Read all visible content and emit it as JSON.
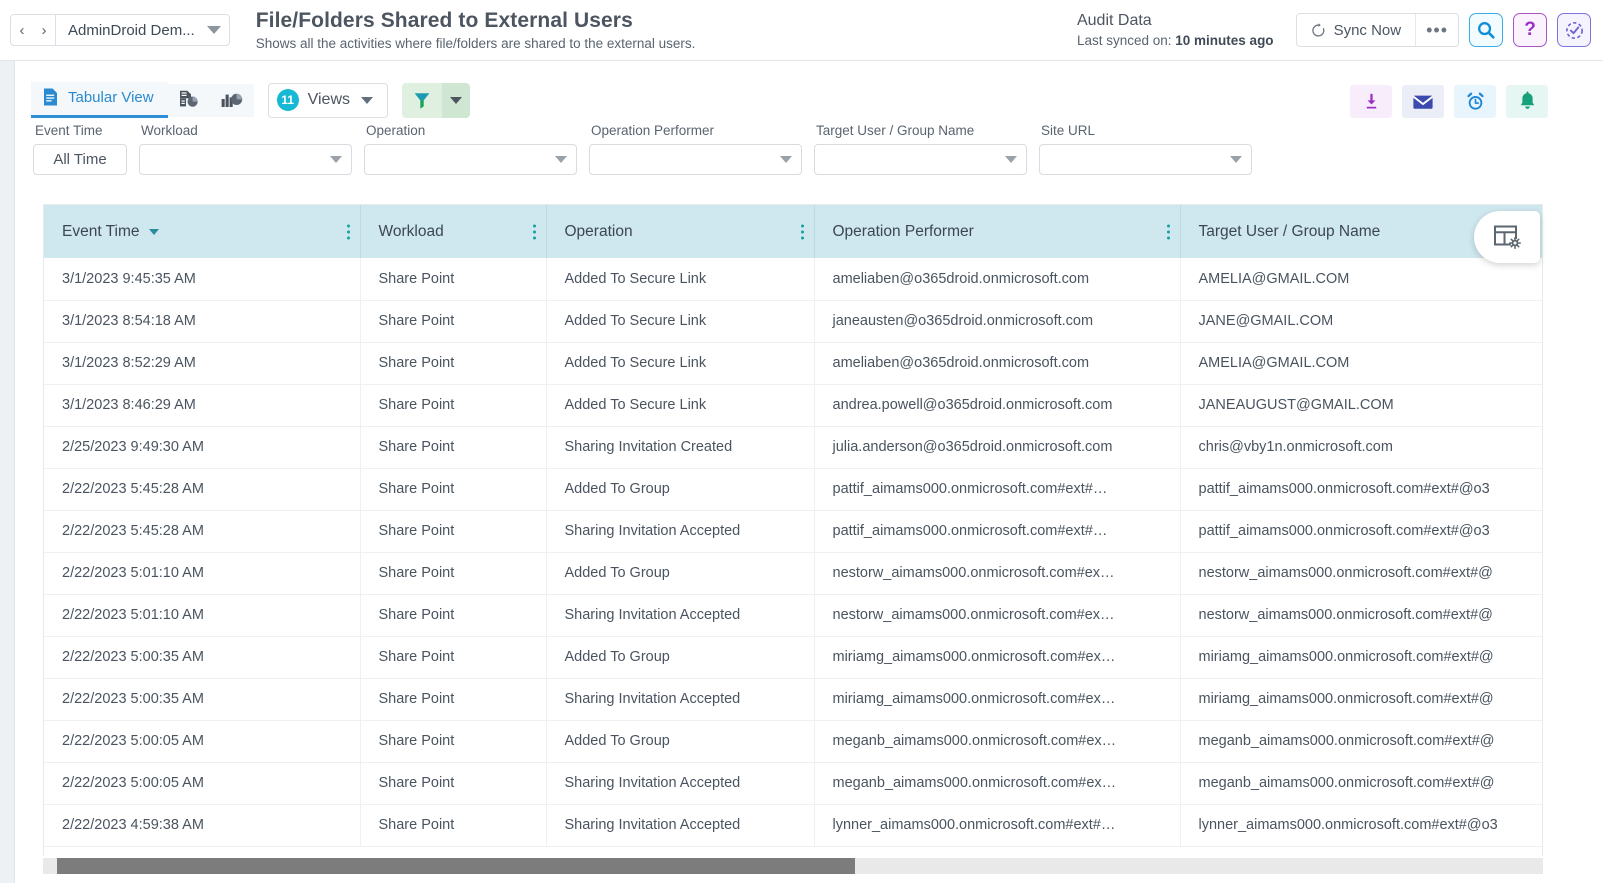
{
  "header": {
    "nav_back": "‹",
    "nav_forward": "›",
    "tenant_name": "AdminDroid Dem...",
    "title": "File/Folders Shared to External Users",
    "subtitle": "Shows all the activities where file/folders are shared to the external users.",
    "audit_label": "Audit Data",
    "sync_prefix": "Last synced on: ",
    "sync_value": "10 minutes ago",
    "sync_button": "Sync Now",
    "more_button": "•••",
    "icons": {
      "search": "search-icon",
      "help": "?",
      "check": "check-circle-icon"
    }
  },
  "viewbar": {
    "tabular_label": "Tabular View",
    "tabular_icon": "document-icon",
    "report_icon": "document-chart-icon",
    "chart_icon": "bar-pie-chart-icon",
    "views_count": "11",
    "views_label": "Views",
    "filter_icon": "funnel-icon"
  },
  "actions": [
    {
      "name": "download-button",
      "icon": "download-icon"
    },
    {
      "name": "email-button",
      "icon": "envelope-icon"
    },
    {
      "name": "schedule-button",
      "icon": "alarm-clock-icon"
    },
    {
      "name": "alert-button",
      "icon": "bell-icon"
    }
  ],
  "filters": [
    {
      "label": "Event Time",
      "value": "All Time",
      "type": "pill"
    },
    {
      "label": "Workload",
      "value": "",
      "placeholder": "",
      "type": "select"
    },
    {
      "label": "Operation",
      "value": "",
      "placeholder": "",
      "type": "select"
    },
    {
      "label": "Operation Performer",
      "value": "",
      "placeholder": "",
      "type": "select"
    },
    {
      "label": "Target User / Group Name",
      "value": "",
      "placeholder": "",
      "type": "select"
    },
    {
      "label": "Site URL",
      "value": "",
      "placeholder": "",
      "type": "select"
    }
  ],
  "table": {
    "settings_icon": "table-settings-icon",
    "columns": [
      "Event Time",
      "Workload",
      "Operation",
      "Operation Performer",
      "Target User / Group Name"
    ],
    "sorted_column": "Event Time",
    "rows": [
      {
        "event_time": "3/1/2023 9:45:35 AM",
        "workload": "Share Point",
        "operation": "Added To Secure Link",
        "performer": "ameliaben@o365droid.onmicrosoft.com",
        "target": "AMELIA@GMAIL.COM"
      },
      {
        "event_time": "3/1/2023 8:54:18 AM",
        "workload": "Share Point",
        "operation": "Added To Secure Link",
        "performer": "janeausten@o365droid.onmicrosoft.com",
        "target": "JANE@GMAIL.COM"
      },
      {
        "event_time": "3/1/2023 8:52:29 AM",
        "workload": "Share Point",
        "operation": "Added To Secure Link",
        "performer": "ameliaben@o365droid.onmicrosoft.com",
        "target": "AMELIA@GMAIL.COM"
      },
      {
        "event_time": "3/1/2023 8:46:29 AM",
        "workload": "Share Point",
        "operation": "Added To Secure Link",
        "performer": "andrea.powell@o365droid.onmicrosoft.com",
        "target": "JANEAUGUST@GMAIL.COM"
      },
      {
        "event_time": "2/25/2023 9:49:30 AM",
        "workload": "Share Point",
        "operation": "Sharing Invitation Created",
        "performer": "julia.anderson@o365droid.onmicrosoft.com",
        "target": "chris@vby1n.onmicrosoft.com"
      },
      {
        "event_time": "2/22/2023 5:45:28 AM",
        "workload": "Share Point",
        "operation": "Added To Group",
        "performer": "pattif_aimams000.onmicrosoft.com#ext#…",
        "target": "pattif_aimams000.onmicrosoft.com#ext#@o3"
      },
      {
        "event_time": "2/22/2023 5:45:28 AM",
        "workload": "Share Point",
        "operation": "Sharing Invitation Accepted",
        "performer": "pattif_aimams000.onmicrosoft.com#ext#…",
        "target": "pattif_aimams000.onmicrosoft.com#ext#@o3"
      },
      {
        "event_time": "2/22/2023 5:01:10 AM",
        "workload": "Share Point",
        "operation": "Added To Group",
        "performer": "nestorw_aimams000.onmicrosoft.com#ex…",
        "target": "nestorw_aimams000.onmicrosoft.com#ext#@"
      },
      {
        "event_time": "2/22/2023 5:01:10 AM",
        "workload": "Share Point",
        "operation": "Sharing Invitation Accepted",
        "performer": "nestorw_aimams000.onmicrosoft.com#ex…",
        "target": "nestorw_aimams000.onmicrosoft.com#ext#@"
      },
      {
        "event_time": "2/22/2023 5:00:35 AM",
        "workload": "Share Point",
        "operation": "Added To Group",
        "performer": "miriamg_aimams000.onmicrosoft.com#ex…",
        "target": "miriamg_aimams000.onmicrosoft.com#ext#@"
      },
      {
        "event_time": "2/22/2023 5:00:35 AM",
        "workload": "Share Point",
        "operation": "Sharing Invitation Accepted",
        "performer": "miriamg_aimams000.onmicrosoft.com#ex…",
        "target": "miriamg_aimams000.onmicrosoft.com#ext#@"
      },
      {
        "event_time": "2/22/2023 5:00:05 AM",
        "workload": "Share Point",
        "operation": "Added To Group",
        "performer": "meganb_aimams000.onmicrosoft.com#ex…",
        "target": "meganb_aimams000.onmicrosoft.com#ext#@"
      },
      {
        "event_time": "2/22/2023 5:00:05 AM",
        "workload": "Share Point",
        "operation": "Sharing Invitation Accepted",
        "performer": "meganb_aimams000.onmicrosoft.com#ex…",
        "target": "meganb_aimams000.onmicrosoft.com#ext#@"
      },
      {
        "event_time": "2/22/2023 4:59:38 AM",
        "workload": "Share Point",
        "operation": "Sharing Invitation Accepted",
        "performer": "lynner_aimams000.onmicrosoft.com#ext#…",
        "target": "lynner_aimams000.onmicrosoft.com#ext#@o3"
      }
    ]
  },
  "colors": {
    "accent_blue": "#2a8ad1",
    "header_teal": "#cfe7ee",
    "badge_cyan": "#17b8d4",
    "filter_green": "#dff0e0"
  }
}
